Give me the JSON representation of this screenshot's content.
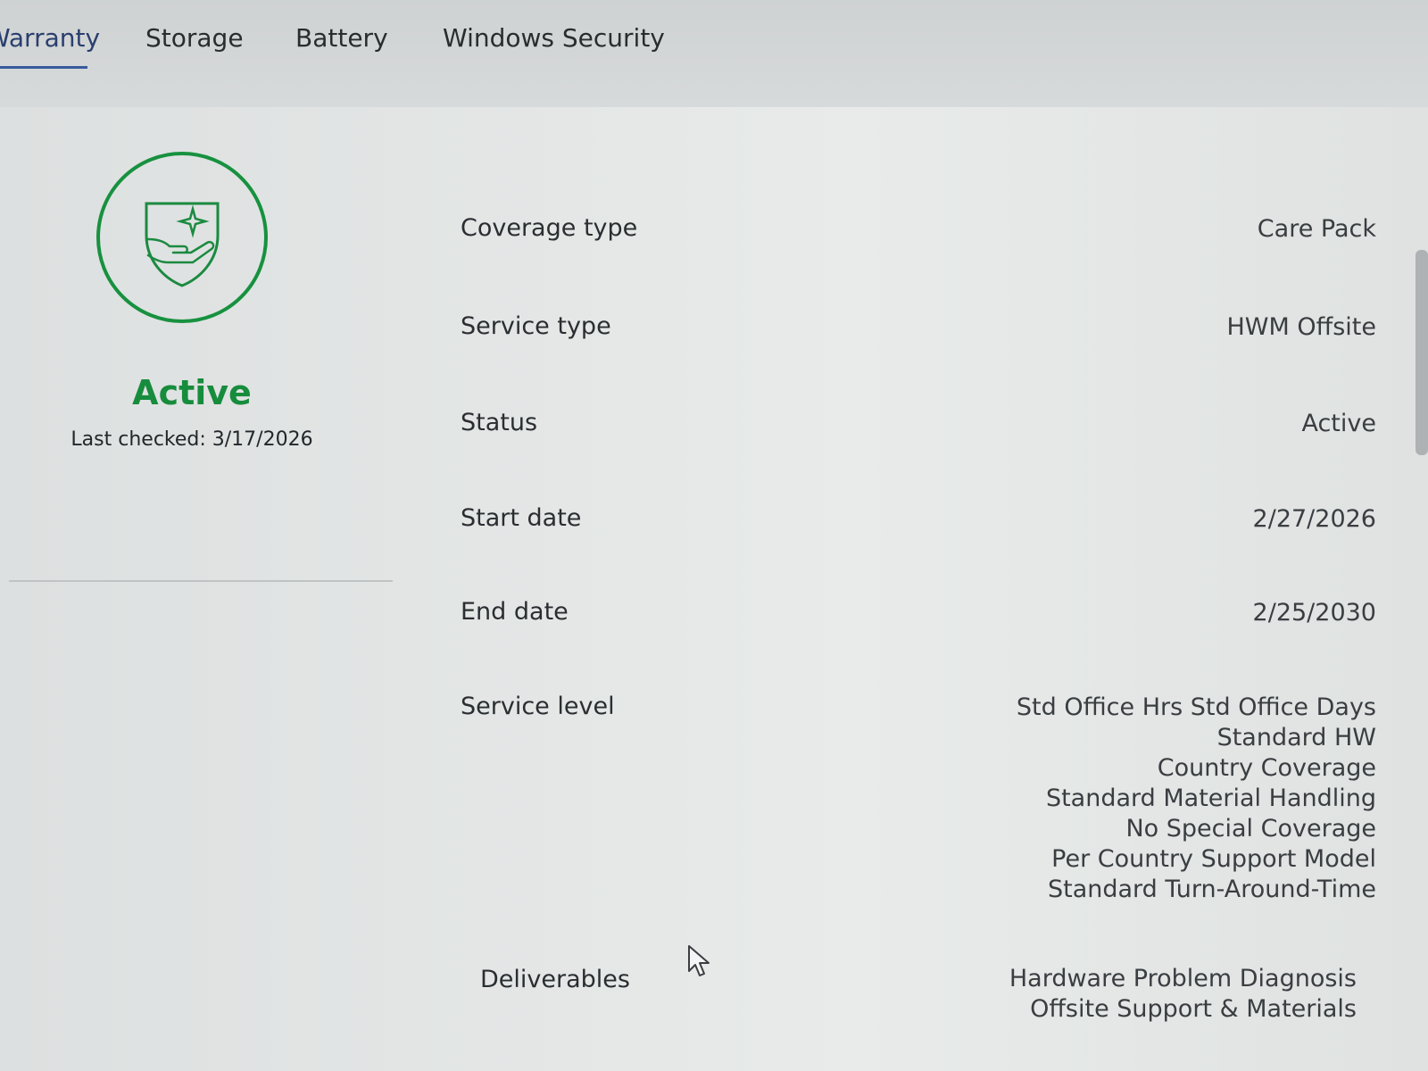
{
  "tabs": [
    {
      "label": "Warranty",
      "active": true
    },
    {
      "label": "Storage",
      "active": false
    },
    {
      "label": "Battery",
      "active": false
    },
    {
      "label": "Windows Security",
      "active": false
    }
  ],
  "summary": {
    "icon": "shield-hand-icon",
    "status": "Active",
    "last_checked": "Last checked: 3/17/2026",
    "accent_color": "#178c3d"
  },
  "details": {
    "coverage_type": {
      "label": "Coverage type",
      "value": "Care Pack"
    },
    "service_type": {
      "label": "Service type",
      "value": "HWM Offsite"
    },
    "status": {
      "label": "Status",
      "value": "Active"
    },
    "start_date": {
      "label": "Start date",
      "value": "2/27/2026"
    },
    "end_date": {
      "label": "End date",
      "value": "2/25/2030"
    },
    "service_level": {
      "label": "Service level",
      "values": [
        "Std Office Hrs Std Office Days",
        "Standard HW",
        "Country Coverage",
        "Standard Material Handling",
        "No Special Coverage",
        "Per Country Support Model",
        "Standard Turn-Around-Time"
      ]
    },
    "deliverables": {
      "label": "Deliverables",
      "values": [
        "Hardware Problem Diagnosis",
        "Offsite Support & Materials"
      ]
    }
  }
}
